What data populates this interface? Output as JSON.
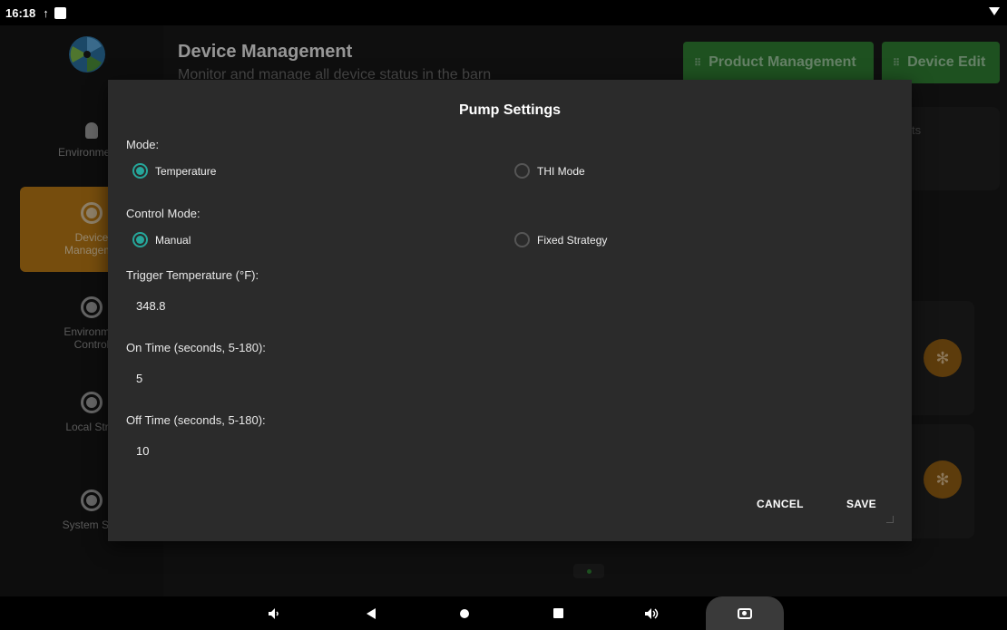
{
  "status_bar": {
    "time": "16:18",
    "upload_glyph": "↑"
  },
  "app": {
    "sidebar": {
      "items": [
        {
          "label": "Environmenta",
          "icon": "lightbulb-icon",
          "active": false
        },
        {
          "label": "Device\nManageme",
          "icon": "radio-icon",
          "active": true
        },
        {
          "label": "Environmer\nControl",
          "icon": "target-icon",
          "active": false
        },
        {
          "label": "Local Strat",
          "icon": "radio-icon",
          "active": false
        },
        {
          "label": "System Sett",
          "icon": "radio-icon",
          "active": false
        }
      ]
    },
    "header": {
      "title": "Device Management",
      "subtitle": "Monitor and manage all device status in the barn",
      "product_btn": "Product Management",
      "device_edit_btn": "Device Edit",
      "btn_glyph": "⠿"
    },
    "bg_card_fragment": "ts",
    "accent": "#2e7d32",
    "active_color": "#b57715"
  },
  "dialog": {
    "title": "Pump Settings",
    "mode_label": "Mode:",
    "mode_options": [
      "Temperature",
      "THI Mode"
    ],
    "mode_selected": "Temperature",
    "control_label": "Control Mode:",
    "control_options": [
      "Manual",
      "Fixed Strategy"
    ],
    "control_selected": "Manual",
    "trigger_label": "Trigger Temperature (°F):",
    "trigger_value": "348.8",
    "on_label": "On Time (seconds, 5-180):",
    "on_value": "5",
    "off_label": "Off Time (seconds, 5-180):",
    "off_value": "10",
    "cancel": "CANCEL",
    "save": "SAVE",
    "radio_color": "#26a69a"
  },
  "navbar": {
    "icons": [
      "volume-down-icon",
      "back-icon",
      "home-icon",
      "recents-icon",
      "volume-up-icon",
      "screenshot-icon"
    ]
  }
}
